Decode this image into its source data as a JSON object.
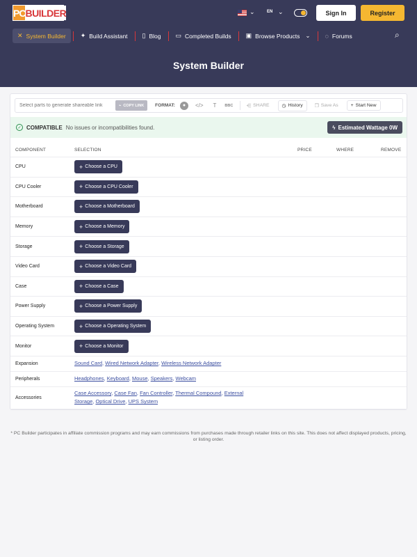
{
  "header": {
    "logo_pc": "PC",
    "logo_builder": "BUILDER",
    "language": "EN",
    "sign_in": "Sign In",
    "register": "Register",
    "page_title": "System Builder"
  },
  "nav": [
    {
      "label": "System Builder",
      "icon": "tools-icon",
      "glyph": "✕",
      "active": true
    },
    {
      "label": "Build Assistant",
      "icon": "sparkle-icon",
      "glyph": "✦"
    },
    {
      "label": "Blog",
      "icon": "book-icon",
      "glyph": "▯"
    },
    {
      "label": "Completed Builds",
      "icon": "monitor-icon",
      "glyph": "▭"
    },
    {
      "label": "Browse Products",
      "icon": "chip-icon",
      "glyph": "▣",
      "chevron": "⌄"
    },
    {
      "label": "Forums",
      "icon": "chat-icon",
      "glyph": "◌"
    }
  ],
  "toolbar": {
    "link_placeholder": "Select parts to generate shareable link",
    "copy_link": "COPY LINK",
    "format": "FORMAT:",
    "format_html": "</>",
    "format_text": "T",
    "format_bbc": "BBC",
    "share": "SHARE",
    "history": "History",
    "save_as": "Save As",
    "start_new": "Start New"
  },
  "compatibility": {
    "status": "COMPATIBLE",
    "message": "No issues or incompatibilities found.",
    "wattage": "Estimated Wattage 0W"
  },
  "table": {
    "headers": {
      "component": "COMPONENT",
      "selection": "SELECTION",
      "price": "PRICE",
      "where": "WHERE",
      "remove": "REMOVE"
    },
    "rows": [
      {
        "name": "CPU",
        "button": "Choose a CPU"
      },
      {
        "name": "CPU Cooler",
        "button": "Choose a CPU Cooler"
      },
      {
        "name": "Motherboard",
        "button": "Choose a Motherboard"
      },
      {
        "name": "Memory",
        "button": "Choose a Memory"
      },
      {
        "name": "Storage",
        "button": "Choose a Storage"
      },
      {
        "name": "Video Card",
        "button": "Choose a Video Card"
      },
      {
        "name": "Case",
        "button": "Choose a Case"
      },
      {
        "name": "Power Supply",
        "button": "Choose a Power Supply"
      },
      {
        "name": "Operating System",
        "button": "Choose a Operating System"
      },
      {
        "name": "Monitor",
        "button": "Choose a Monitor"
      }
    ],
    "link_rows": [
      {
        "name": "Expansion",
        "links": [
          "Sound Card",
          "Wired Network Adapter",
          "Wireless Network Adapter"
        ]
      },
      {
        "name": "Peripherals",
        "links": [
          "Headphones",
          "Keyboard",
          "Mouse",
          "Speakers",
          "Webcam"
        ]
      },
      {
        "name": "Accessories",
        "links": [
          "Case Accessory",
          "Case Fan",
          "Fan Controller",
          "Thermal Compound",
          "External Storage",
          "Optical Drive",
          "UPS System"
        ]
      }
    ]
  },
  "footnote": "* PC Builder participates in affiliate commission programs and may earn commissions from purchases made through retailer links on this site. This does not affect displayed products, pricing, or listing order."
}
